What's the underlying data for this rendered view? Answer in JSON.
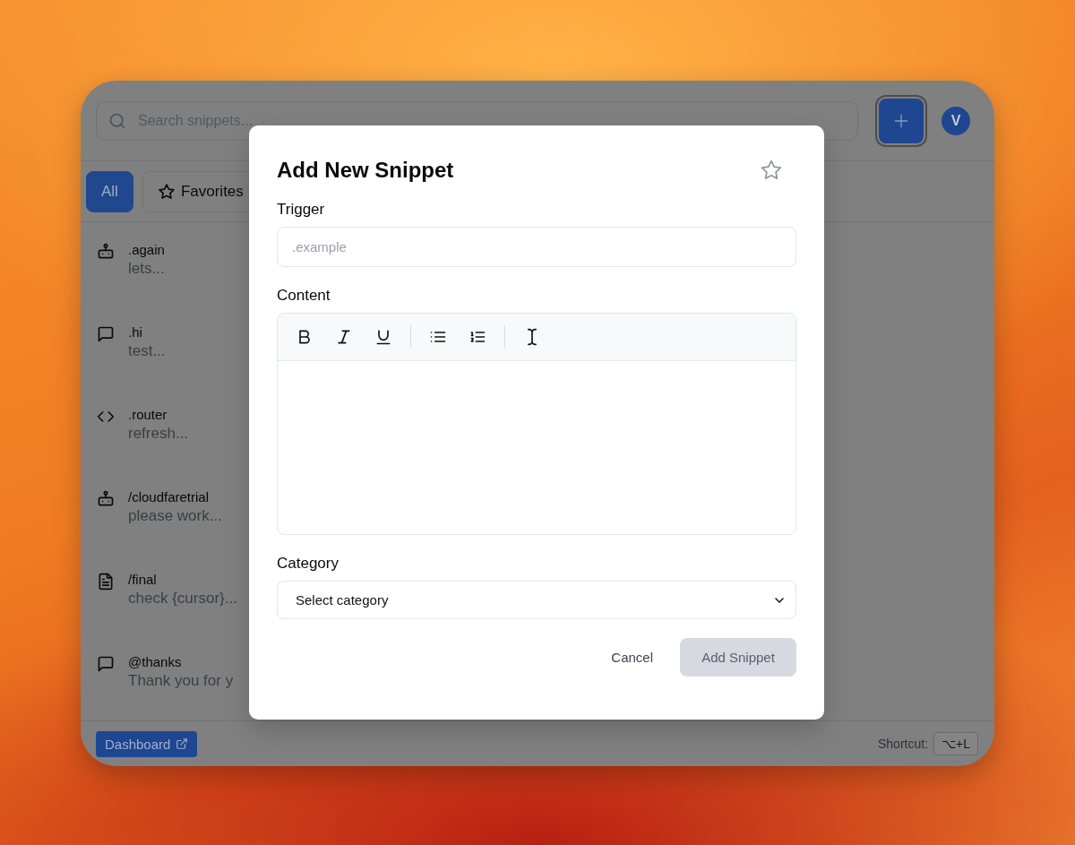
{
  "search": {
    "placeholder": "Search snippets..."
  },
  "add_button": {
    "focused": true
  },
  "avatar": {
    "initial": "V"
  },
  "filters": [
    {
      "label": "All",
      "selected": true,
      "kind": "plain"
    },
    {
      "label": "Favorites",
      "selected": false,
      "kind": "star"
    }
  ],
  "snippets": [
    {
      "kind": "bot",
      "trigger": ".again",
      "preview": "lets..."
    },
    {
      "kind": "message",
      "trigger": ".hi",
      "preview": "test..."
    },
    {
      "kind": "code",
      "trigger": ".router",
      "preview": "refresh..."
    },
    {
      "kind": "bot",
      "trigger": "/cloudfaretrial",
      "preview": "please work..."
    },
    {
      "kind": "document",
      "trigger": "/final",
      "preview": "check {cursor}..."
    },
    {
      "kind": "message",
      "trigger": "@thanks",
      "preview": "Thank you for y"
    }
  ],
  "footer": {
    "dashboard": "Dashboard",
    "shortcut_label": "Shortcut:",
    "shortcut_key": "⌥+L"
  },
  "dialog": {
    "title": "Add New Snippet",
    "favorite": false,
    "trigger_label": "Trigger",
    "trigger_placeholder": ".example",
    "content_label": "Content",
    "toolbar": [
      {
        "kind": "bold"
      },
      {
        "kind": "italic"
      },
      {
        "kind": "underline"
      },
      {
        "kind": "divider"
      },
      {
        "kind": "bullet_list"
      },
      {
        "kind": "ordered_list"
      },
      {
        "kind": "divider"
      },
      {
        "kind": "text_cursor"
      }
    ],
    "category_label": "Category",
    "category_value": "Select category",
    "cancel": "Cancel",
    "submit": "Add Snippet",
    "submit_disabled": true
  }
}
